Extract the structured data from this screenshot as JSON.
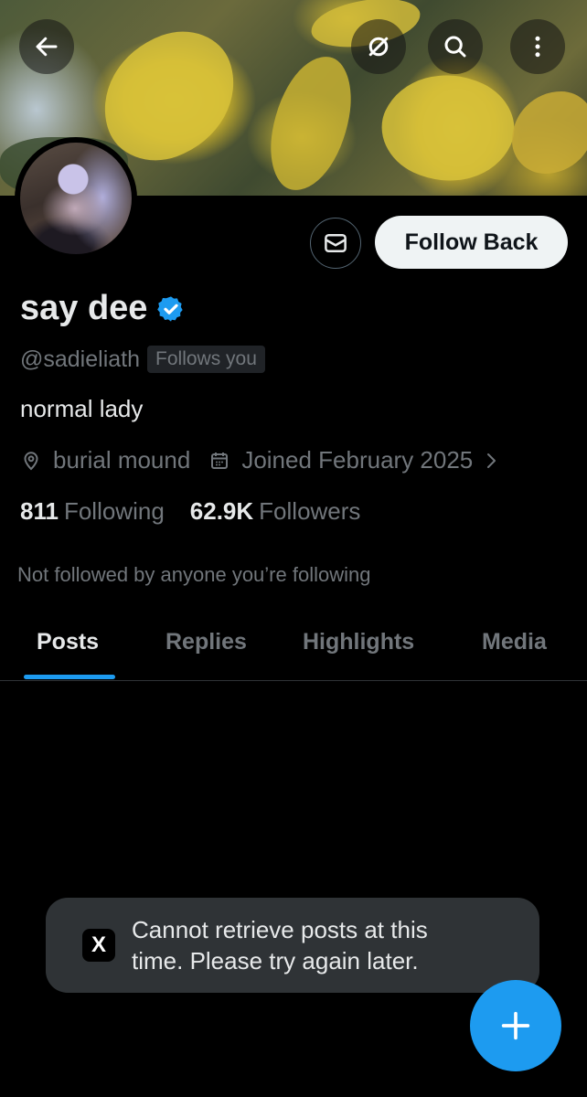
{
  "profile": {
    "display_name": "say dee",
    "handle": "@sadieliath",
    "follows_you_badge": "Follows you",
    "bio": "normal lady",
    "location": "burial mound",
    "joined": "Joined February 2025",
    "following_count": "811",
    "following_label": "Following",
    "followers_count": "62.9K",
    "followers_label": "Followers",
    "mutuals_note": "Not followed by anyone you’re following"
  },
  "actions": {
    "follow_back_label": "Follow Back"
  },
  "tabs": [
    {
      "label": "Posts",
      "active": true
    },
    {
      "label": "Replies",
      "active": false
    },
    {
      "label": "Highlights",
      "active": false
    },
    {
      "label": "Media",
      "active": false
    }
  ],
  "toast": {
    "icon_glyph": "X",
    "message": "Cannot retrieve posts at this time. Please try again later."
  },
  "colors": {
    "accent": "#1d9bf0",
    "background": "#000000",
    "muted_text": "#71767b"
  },
  "icons": {
    "top_bar": [
      "back-arrow-icon",
      "grok-icon",
      "search-icon",
      "more-vertical-icon"
    ],
    "meta": [
      "location-pin-icon",
      "calendar-icon",
      "chevron-right-icon"
    ],
    "message": "envelope-icon",
    "verified": "verified-badge-icon",
    "fab": "plus-icon"
  }
}
